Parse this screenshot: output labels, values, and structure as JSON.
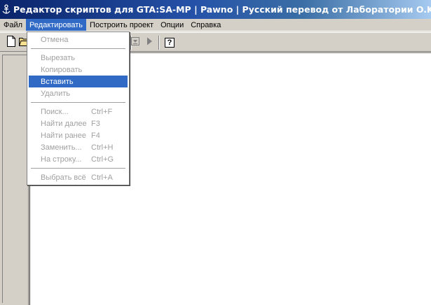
{
  "window": {
    "title": "Редактор скриптов для GTA:SA-MP | Pawno | Русский перевод от Лаборатории O.K.Style",
    "icon": "pawno-app-icon"
  },
  "menubar": {
    "items": [
      {
        "label": "Файл",
        "active": false
      },
      {
        "label": "Редактировать",
        "active": true
      },
      {
        "label": "Построить проект",
        "active": false
      },
      {
        "label": "Опции",
        "active": false
      },
      {
        "label": "Справка",
        "active": false
      }
    ]
  },
  "toolbar": {
    "buttons": [
      "new-file-icon",
      "open-folder-icon",
      "compile-icon",
      "run-icon",
      "help-icon"
    ],
    "help_glyph": "?"
  },
  "edit_menu": {
    "items": [
      {
        "label": "Отмена",
        "shortcut": "",
        "enabled": false,
        "highlighted": false
      },
      {
        "label": "Вырезать",
        "shortcut": "",
        "enabled": false,
        "highlighted": false
      },
      {
        "label": "Копировать",
        "shortcut": "",
        "enabled": false,
        "highlighted": false
      },
      {
        "label": "Вставить",
        "shortcut": "",
        "enabled": false,
        "highlighted": true
      },
      {
        "label": "Удалить",
        "shortcut": "",
        "enabled": false,
        "highlighted": false
      },
      {
        "label": "Поиск...",
        "shortcut": "Ctrl+F",
        "enabled": false,
        "highlighted": false
      },
      {
        "label": "Найти далее",
        "shortcut": "F3",
        "enabled": false,
        "highlighted": false
      },
      {
        "label": "Найти ранее",
        "shortcut": "F4",
        "enabled": false,
        "highlighted": false
      },
      {
        "label": "Заменить...",
        "shortcut": "Ctrl+H",
        "enabled": false,
        "highlighted": false
      },
      {
        "label": "На строку...",
        "shortcut": "Ctrl+G",
        "enabled": false,
        "highlighted": false
      },
      {
        "label": "Выбрать всё",
        "shortcut": "Ctrl+A",
        "enabled": false,
        "highlighted": false
      }
    ]
  },
  "colors": {
    "title_start": "#0a246a",
    "title_end": "#a6caf0",
    "highlight": "#316ac5",
    "chrome": "#d4d0c8",
    "disabled_text": "#a0a0a0"
  }
}
